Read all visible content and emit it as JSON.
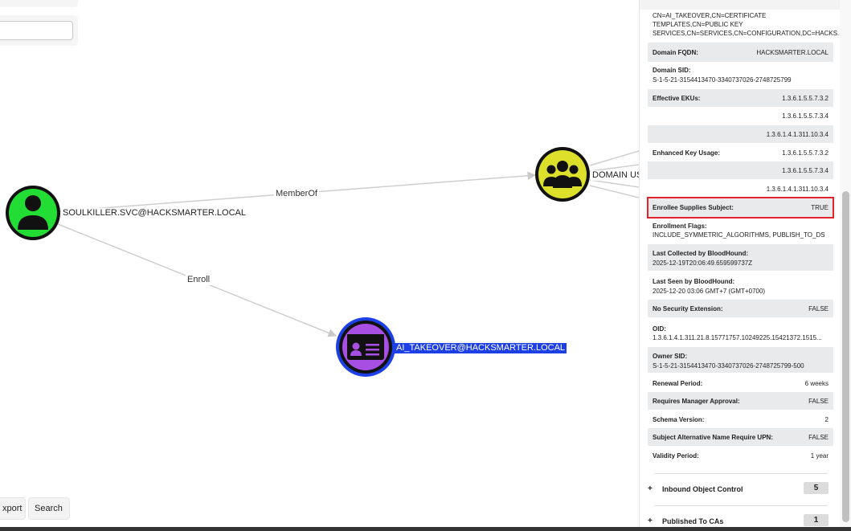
{
  "graph": {
    "nodes": [
      {
        "label": "SOULKILLER.SVC@HACKSMARTER.LOCAL",
        "color": "#22dd33",
        "icon": "user-icon"
      },
      {
        "label": "DOMAIN US",
        "color": "#dde02a",
        "icon": "group-icon"
      },
      {
        "label": "AI_TAKEOVER@HACKSMARTER.LOCAL",
        "color": "#a64fe2",
        "icon": "certificate-template-icon",
        "selected": true
      }
    ],
    "edges": [
      {
        "label": "MemberOf"
      },
      {
        "label": "Enroll"
      }
    ]
  },
  "toolbar": {
    "export_label": "xport",
    "search_label": "Search"
  },
  "panel": {
    "dn_lines": [
      "CN=AI_TAKEOVER,CN=CERTIFICATE",
      "TEMPLATES,CN=PUBLIC KEY",
      "SERVICES,CN=SERVICES,CN=CONFIGURATION,DC=HACKS..."
    ],
    "props": {
      "domain_fqdn_k": "Domain FQDN:",
      "domain_fqdn_v": "HACKSMARTER.LOCAL",
      "domain_sid_k": "Domain SID:",
      "domain_sid_v": "S-1-5-21-3154413470-3340737026-2748725799",
      "eff_ekus_k": "Effective EKUs:",
      "eff_ekus_v": [
        "1.3.6.1.5.5.7.3.2",
        "1.3.6.1.5.5.7.3.4",
        "1.3.6.1.4.1.311.10.3.4"
      ],
      "enh_ku_k": "Enhanced Key Usage:",
      "enh_ku_v": [
        "1.3.6.1.5.5.7.3.2",
        "1.3.6.1.5.5.7.3.4",
        "1.3.6.1.4.1.311.10.3.4"
      ],
      "enrollee_k": "Enrollee Supplies Subject:",
      "enrollee_v": "TRUE",
      "enroll_flags_k": "Enrollment Flags:",
      "enroll_flags_v": "INCLUDE_SYMMETRIC_ALGORITHMS, PUBLISH_TO_DS",
      "last_collected_k": "Last Collected by BloodHound:",
      "last_collected_v": "2025-12-19T20:06:49.659599737Z",
      "last_seen_k": "Last Seen by BloodHound:",
      "last_seen_v": "2025-12-20 03:06 GMT+7 (GMT+0700)",
      "no_sec_k": "No Security Extension:",
      "no_sec_v": "FALSE",
      "oid_k": "OID:",
      "oid_v": "1.3.6.1.4.1.311.21.8.15771757.10249225.15421372.1515...",
      "owner_sid_k": "Owner SID:",
      "owner_sid_v": "S-1-5-21-3154413470-3340737026-2748725799-500",
      "renewal_k": "Renewal Period:",
      "renewal_v": "6 weeks",
      "mgr_k": "Requires Manager Approval:",
      "mgr_v": "FALSE",
      "schema_k": "Schema Version:",
      "schema_v": "2",
      "san_upn_k": "Subject Alternative Name Require UPN:",
      "san_upn_v": "FALSE",
      "validity_k": "Validity Period:",
      "validity_v": "1 year"
    },
    "sections": [
      {
        "label": "Inbound Object Control",
        "count": "5"
      },
      {
        "label": "Published To CAs",
        "count": "1"
      }
    ]
  },
  "colors": {
    "highlight": "#e2242c",
    "selection": "#1d3fe6"
  }
}
